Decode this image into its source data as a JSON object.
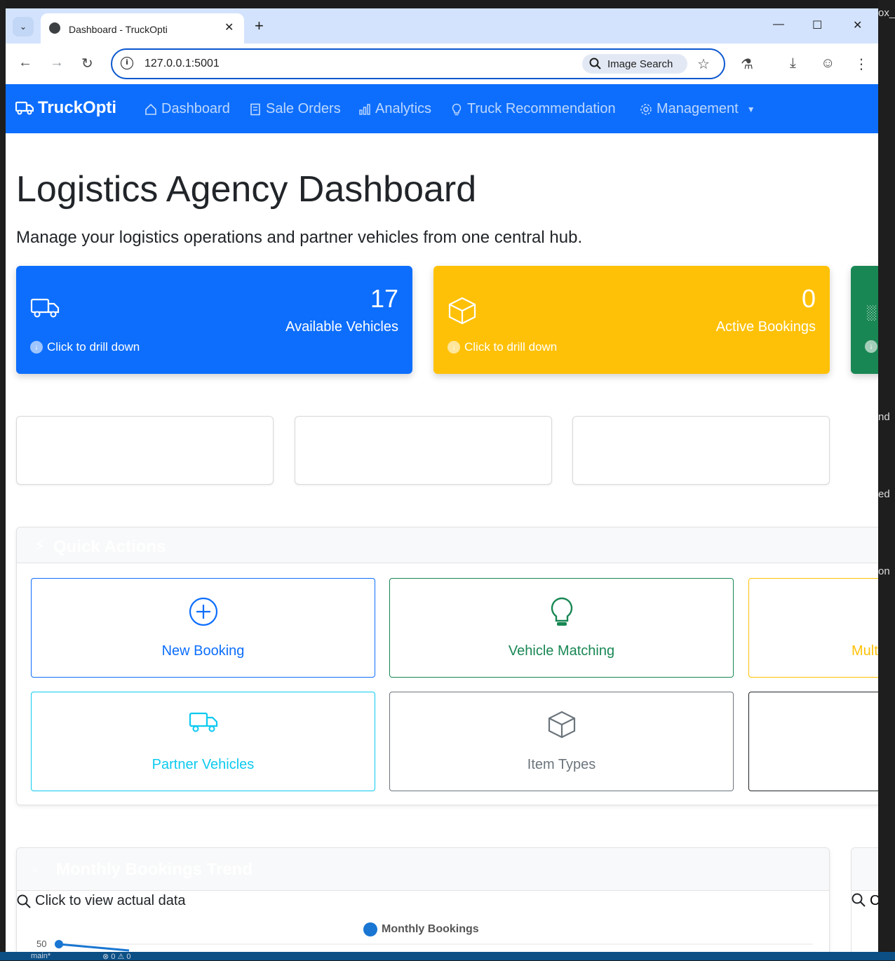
{
  "browser": {
    "tab_title": "Dashboard - TruckOpti",
    "url": "127.0.0.1:5001",
    "image_search_label": "Image Search"
  },
  "navbar": {
    "brand": "TruckOpti",
    "items": [
      {
        "label": "Dashboard",
        "icon": "house-icon"
      },
      {
        "label": "Sale Orders",
        "icon": "receipt-icon"
      },
      {
        "label": "Analytics",
        "icon": "bar-chart-icon"
      },
      {
        "label": "Truck Recommendation",
        "icon": "lightbulb-icon"
      },
      {
        "label": "Management",
        "icon": "gear-icon"
      }
    ]
  },
  "header": {
    "title": "Logistics Agency Dashboard",
    "lead": "Manage your logistics operations and partner vehicles from one central hub."
  },
  "stats": [
    {
      "value": "17",
      "label": "Available Vehicles",
      "drill": "Click to drill down",
      "color": "#0d6efd",
      "icon": "truck-icon"
    },
    {
      "value": "0",
      "label": "Active Bookings",
      "drill": "Click to drill down",
      "color": "#ffc107",
      "icon": "box-icon"
    },
    {
      "value": "",
      "label": "",
      "drill": "",
      "color": "#198754",
      "icon": "bar-chart-icon"
    }
  ],
  "quick_actions": {
    "title": "Quick Actions",
    "buttons": [
      {
        "label": "New Booking",
        "color": "#0d6efd",
        "icon": "plus-circle-icon"
      },
      {
        "label": "Vehicle Matching",
        "color": "#198754",
        "icon": "lightbulb-icon"
      },
      {
        "label": "Mult",
        "color": "#ffc107",
        "icon": ""
      },
      {
        "label": "Partner Vehicles",
        "color": "#0dcaf0",
        "icon": "truck-icon"
      },
      {
        "label": "Item Types",
        "color": "#6c757d",
        "icon": "box-icon"
      },
      {
        "label": "",
        "color": "#212529",
        "icon": ""
      }
    ]
  },
  "trend": {
    "title": "Monthly Bookings Trend",
    "hint": "Click to view actual data",
    "side_hint": "C"
  },
  "chart_data": {
    "type": "line",
    "title": "",
    "series": [
      {
        "name": "Monthly Bookings",
        "values": [
          50
        ]
      }
    ],
    "y_visible_tick": "50"
  },
  "desktop": {
    "right_snippets": [
      "ox_",
      "nd",
      "ed",
      "on"
    ],
    "status_branch": "main*",
    "status_counts": "⊗ 0 ⚠ 0"
  }
}
